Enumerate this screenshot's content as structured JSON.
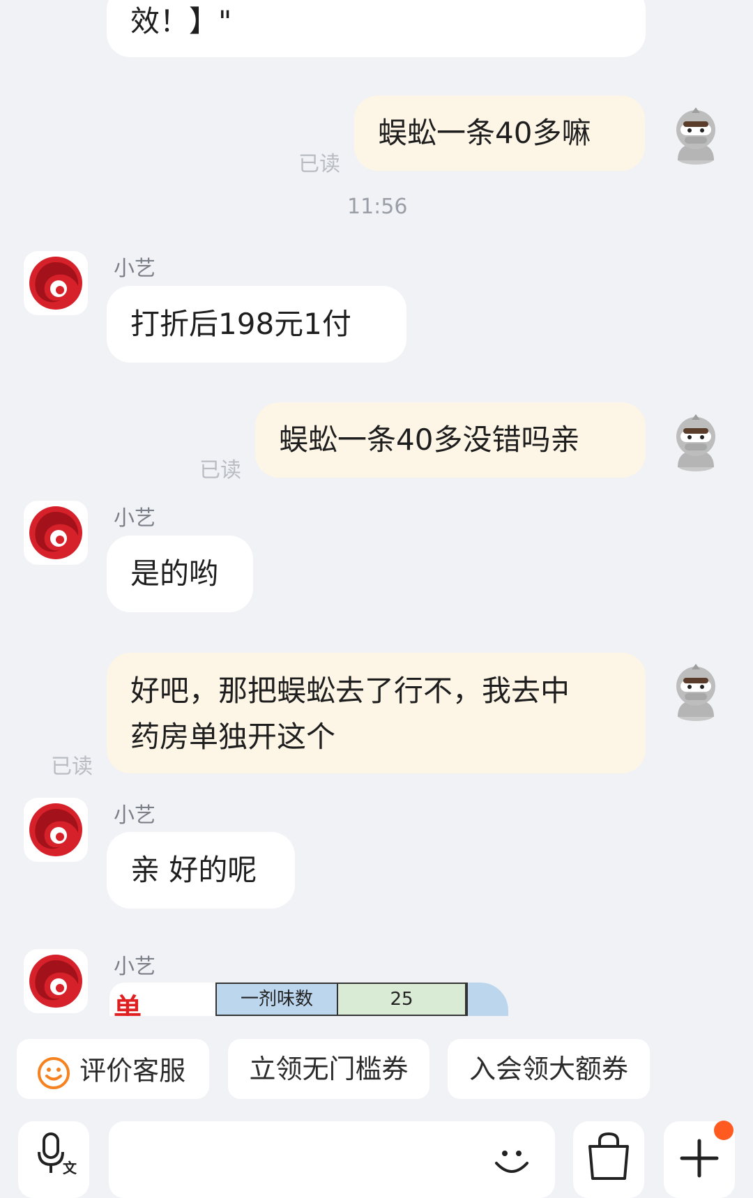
{
  "messages": {
    "m0": {
      "text": "效！】\""
    },
    "m1": {
      "text": "蜈蚣一条40多嘛",
      "read": "已读"
    },
    "timestamp": "11:56",
    "m2": {
      "sender": "小艺",
      "text": "打折后198元1付"
    },
    "m3": {
      "text": "蜈蚣一条40多没错吗亲",
      "read": "已读"
    },
    "m4": {
      "sender": "小艺",
      "text": "是的哟"
    },
    "m5": {
      "line1": "好吧，那把蜈蚣去了行不，我去中",
      "line2": "药房单独开这个",
      "read": "已读"
    },
    "m6": {
      "sender": "小艺",
      "text": "亲 好的呢"
    },
    "m7": {
      "sender": "小艺",
      "table_label": "一剂味数",
      "table_value": "25",
      "partial_char": "单"
    }
  },
  "quick_actions": {
    "rate": "评价客服",
    "coupon": "立领无门槛券",
    "join": "入会领大额券"
  },
  "colors": {
    "background": "#f0f2f6",
    "incoming_bubble": "#ffffff",
    "outgoing_bubble": "#fdf5e6",
    "brand_red": "#d6202a",
    "badge": "#ff5a1f",
    "smile_orange": "#f5821f"
  },
  "icons": [
    "voice-input-icon",
    "emoji-icon",
    "shopping-bag-icon",
    "plus-icon",
    "smile-icon",
    "bot-logo-icon",
    "user-avatar-icon"
  ]
}
